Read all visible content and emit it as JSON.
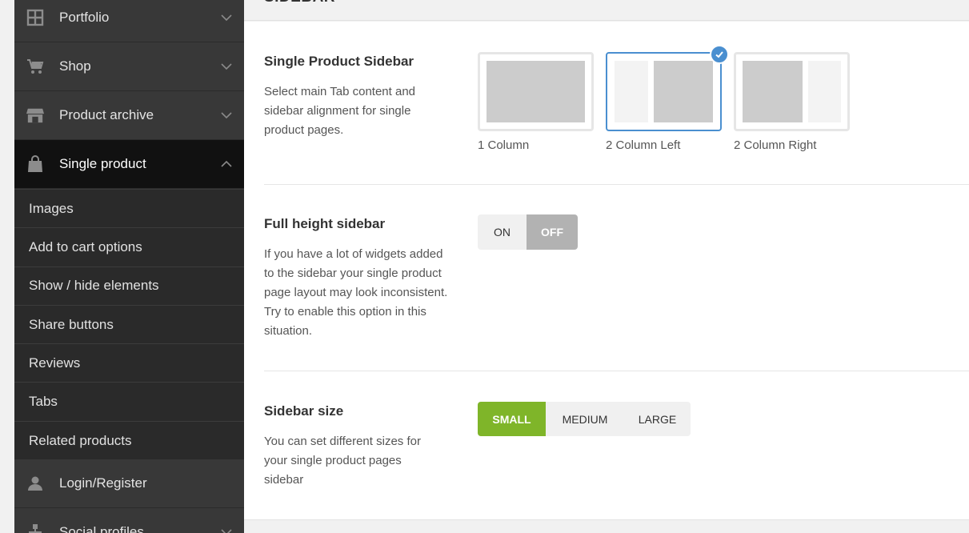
{
  "header": {
    "section_title": "SIDEBAR"
  },
  "sidebar": {
    "items": [
      {
        "label": "Portfolio",
        "icon": "grid-icon"
      },
      {
        "label": "Shop",
        "icon": "cart-icon"
      },
      {
        "label": "Product archive",
        "icon": "store-icon"
      },
      {
        "label": "Single product",
        "icon": "bag-icon",
        "active": true
      },
      {
        "label": "Login/Register",
        "icon": "user-icon"
      },
      {
        "label": "Social profiles",
        "icon": "network-icon"
      }
    ],
    "sub_items": [
      "Images",
      "Add to cart options",
      "Show / hide elements",
      "Share buttons",
      "Reviews",
      "Tabs",
      "Related products"
    ]
  },
  "options": {
    "single_product_sidebar": {
      "title": "Single Product Sidebar",
      "description": "Select main Tab content and sidebar alignment for single product pages.",
      "choices": [
        "1 Column",
        "2 Column Left",
        "2 Column Right"
      ],
      "selected": "2 Column Left"
    },
    "full_height_sidebar": {
      "title": "Full height sidebar",
      "description": "If you have a lot of widgets added to the sidebar your single product page layout may look inconsistent. Try to enable this option in this situation.",
      "on_label": "ON",
      "off_label": "OFF",
      "value": "OFF"
    },
    "sidebar_size": {
      "title": "Sidebar size",
      "description": "You can set different sizes for your single product pages sidebar",
      "sizes": [
        "SMALL",
        "MEDIUM",
        "LARGE"
      ],
      "selected": "SMALL"
    }
  },
  "colors": {
    "accent_blue": "#4a8fd0",
    "accent_green": "#7fb529",
    "sidebar_bg": "#383838",
    "sidebar_active": "#111111"
  }
}
